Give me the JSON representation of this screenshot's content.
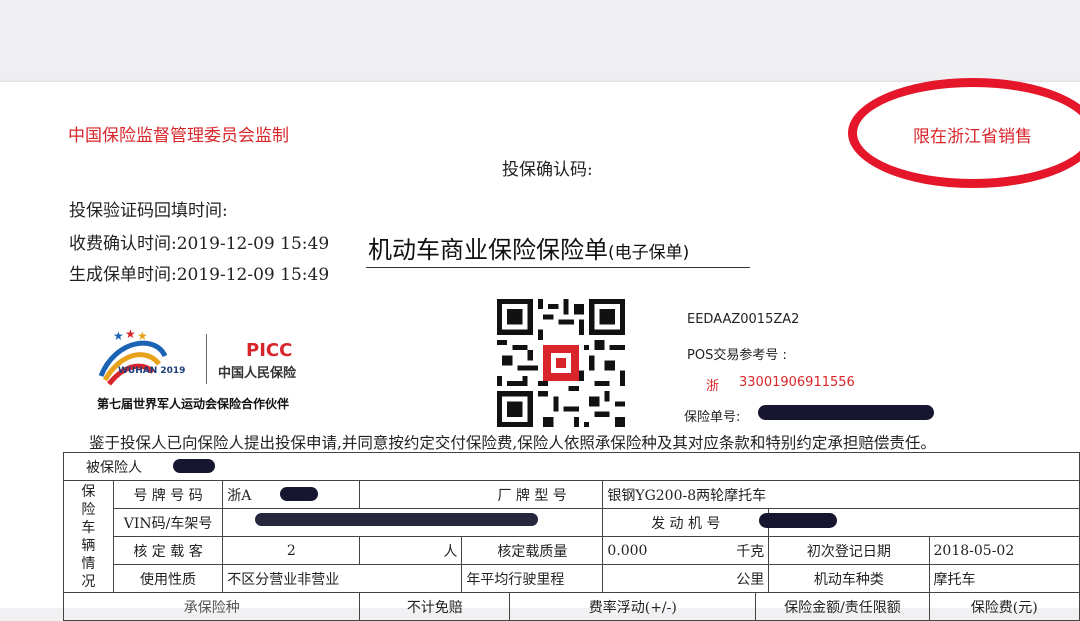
{
  "header": {
    "supervision": "中国保险监督管理委员会监制",
    "sale_region": "限在浙江省销售",
    "confirm_code_label": "投保确认码:",
    "verify_time_label": "投保验证码回填时间:",
    "fee_confirm_time": "收费确认时间:2019-12-09 15:49",
    "policy_gen_time": "生成保单时间:2019-12-09 15:49"
  },
  "title": {
    "main": "机动车商业保险保险单",
    "sub": "(电子保单)"
  },
  "logos": {
    "wuhan_text": "WUHAN 2019",
    "picc_text": "PICC",
    "picc_cn": "中国人民保险",
    "partner_caption": "第七届世界军人运动会保险合作伙伴"
  },
  "codes": {
    "doc_code": "EEDAAZ0015ZA2",
    "pos_label": "POS交易参考号 :",
    "province_prefix": "浙",
    "serial_number": "33001906911556",
    "policy_no_label": "保险单号:"
  },
  "statement": "鉴于投保人已向保险人提出投保申请,并同意按约定交付保险费,保险人依照承保险种及其对应条款和特别约定承担赔偿责任。",
  "table": {
    "insured_label": "被保险人",
    "vehicle_section_label": "保 险 车 辆 情 况",
    "plate_label": "号 牌 号 码",
    "plate_value": "浙A",
    "brand_label": "厂 牌 型 号",
    "brand_value": "银钢YG200-8两轮摩托车",
    "vin_label": "VIN码/车架号",
    "engine_label": "发 动 机 号",
    "seats_label": "核 定 载 客",
    "seats_value": "2",
    "seats_unit": "人",
    "mass_label": "核定载质量",
    "mass_value": "0.000",
    "mass_unit": "千克",
    "reg_date_label": "初次登记日期",
    "reg_date_value": "2018-05-02",
    "usage_label": "使用性质",
    "usage_value": "不区分营业非营业",
    "mileage_label": "年平均行驶里程",
    "mileage_unit": "公里",
    "vehicle_type_label": "机动车种类",
    "vehicle_type_value": "摩托车",
    "next_headers": [
      "承保险种",
      "不计免赔",
      "费率浮动(+/-)",
      "保险金额/责任限额",
      "保险费(元)"
    ]
  }
}
